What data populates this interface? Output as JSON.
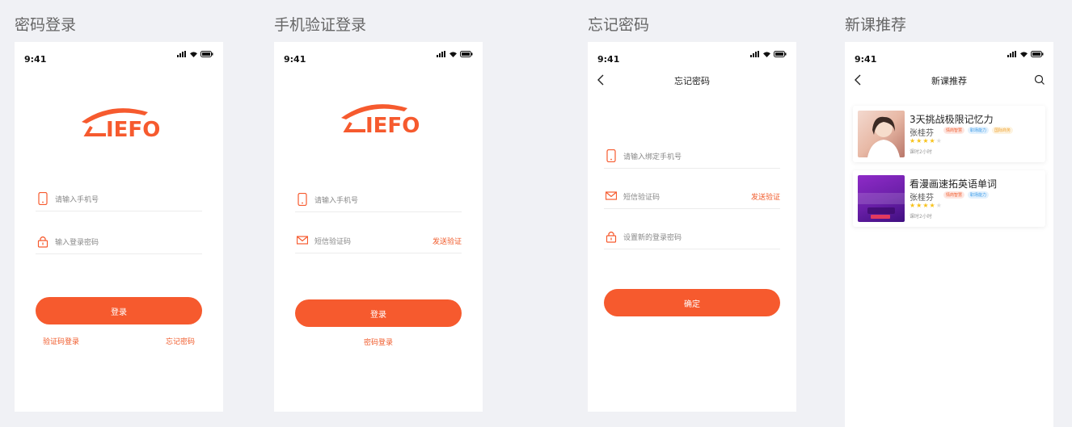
{
  "colors": {
    "accent": "#f65a2e",
    "star": "#f7c21a",
    "star_empty": "#dddddd"
  },
  "screens": {
    "password_login": {
      "board_title": "密码登录",
      "time": "9:41",
      "phone_placeholder": "请输入手机号",
      "password_placeholder": "输入登录密码",
      "login_button": "登录",
      "sms_login_link": "验证码登录",
      "forgot_link": "忘记密码"
    },
    "sms_login": {
      "board_title": "手机验证登录",
      "time": "9:41",
      "phone_placeholder": "请输入手机号",
      "code_placeholder": "短信验证码",
      "send_code": "发送验证",
      "login_button": "登录",
      "password_login_link": "密码登录"
    },
    "forgot_password": {
      "board_title": "忘记密码",
      "time": "9:41",
      "nav_title": "忘记密码",
      "phone_placeholder": "请输入绑定手机号",
      "code_placeholder": "短信验证码",
      "send_code": "发送验证",
      "new_password_placeholder": "设置新的登录密码",
      "confirm_button": "确定"
    },
    "course_recommend": {
      "board_title": "新课推荐",
      "time": "9:41",
      "nav_title": "新课推荐",
      "courses": [
        {
          "title": "3天挑战极限记忆力",
          "teacher": "张桂芬",
          "tags": [
            "情商智慧",
            "职场能力",
            "国际商务"
          ],
          "rating": 4,
          "hours": "课时2小时"
        },
        {
          "title": "看漫画速拓英语单词",
          "teacher": "张桂芬",
          "tags": [
            "情商智慧",
            "职场能力"
          ],
          "rating": 4,
          "hours": "课时2小时"
        }
      ]
    }
  }
}
